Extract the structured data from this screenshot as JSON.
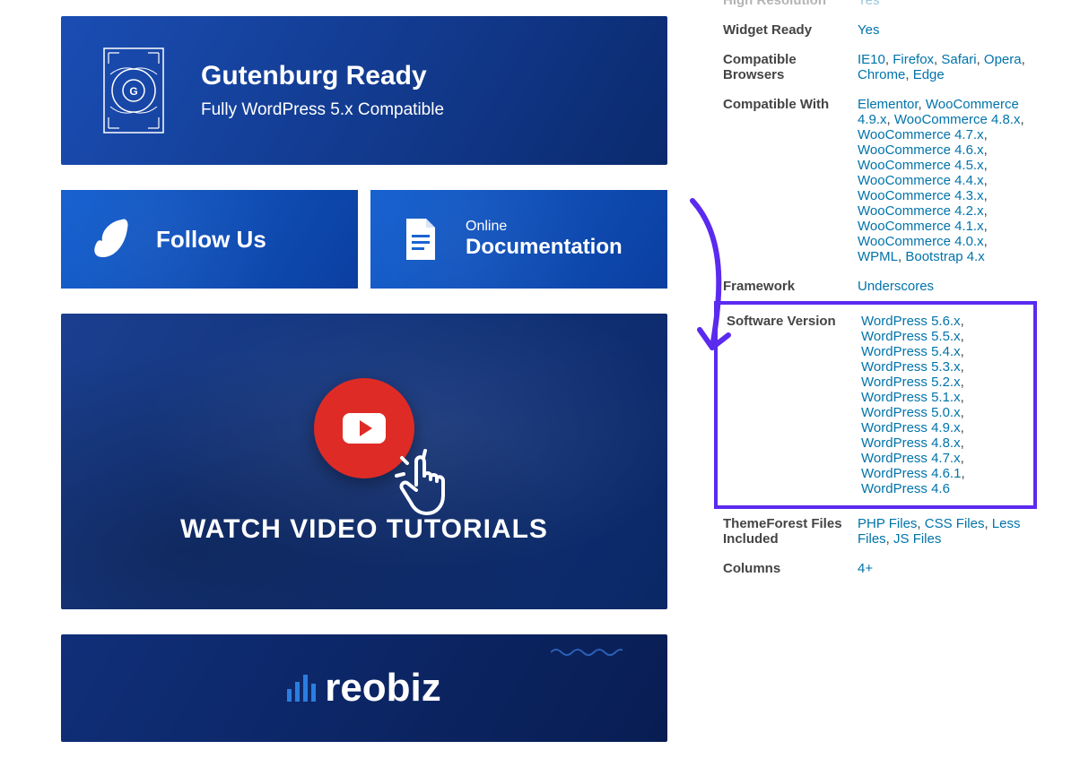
{
  "banners": {
    "gutenburg": {
      "title": "Gutenburg Ready",
      "subtitle": "Fully WordPress 5.x Compatible"
    },
    "follow": {
      "label": "Follow Us"
    },
    "docs": {
      "line1": "Online",
      "line2": "Documentation"
    },
    "video": {
      "title": "WATCH VIDEO TUTORIALS"
    },
    "logo": {
      "name": "reobiz"
    }
  },
  "specs": {
    "highResolution": {
      "label": "High Resolution",
      "value": "Yes"
    },
    "widgetReady": {
      "label": "Widget Ready",
      "value": "Yes"
    },
    "browsers": {
      "label": "Compatible Browsers",
      "items": [
        "IE10",
        "Firefox",
        "Safari",
        "Opera",
        "Chrome",
        "Edge"
      ]
    },
    "compatibleWith": {
      "label": "Compatible With",
      "items": [
        "Elementor",
        "WooCommerce 4.9.x",
        "WooCommerce 4.8.x",
        "WooCommerce 4.7.x",
        "WooCommerce 4.6.x",
        "WooCommerce 4.5.x",
        "WooCommerce 4.4.x",
        "WooCommerce 4.3.x",
        "WooCommerce 4.2.x",
        "WooCommerce 4.1.x",
        "WooCommerce 4.0.x",
        "WPML",
        "Bootstrap 4.x"
      ]
    },
    "framework": {
      "label": "Framework",
      "items": [
        "Underscores"
      ]
    },
    "softwareVersion": {
      "label": "Software Version",
      "items": [
        "WordPress 5.6.x",
        "WordPress 5.5.x",
        "WordPress 5.4.x",
        "WordPress 5.3.x",
        "WordPress 5.2.x",
        "WordPress 5.1.x",
        "WordPress 5.0.x",
        "WordPress 4.9.x",
        "WordPress 4.8.x",
        "WordPress 4.7.x",
        "WordPress 4.6.1",
        "WordPress 4.6"
      ]
    },
    "tfFiles": {
      "label": "ThemeForest Files Included",
      "items": [
        "PHP Files",
        "CSS Files",
        "Less Files",
        "JS Files"
      ]
    },
    "columns": {
      "label": "Columns",
      "items": [
        "4+"
      ]
    }
  }
}
